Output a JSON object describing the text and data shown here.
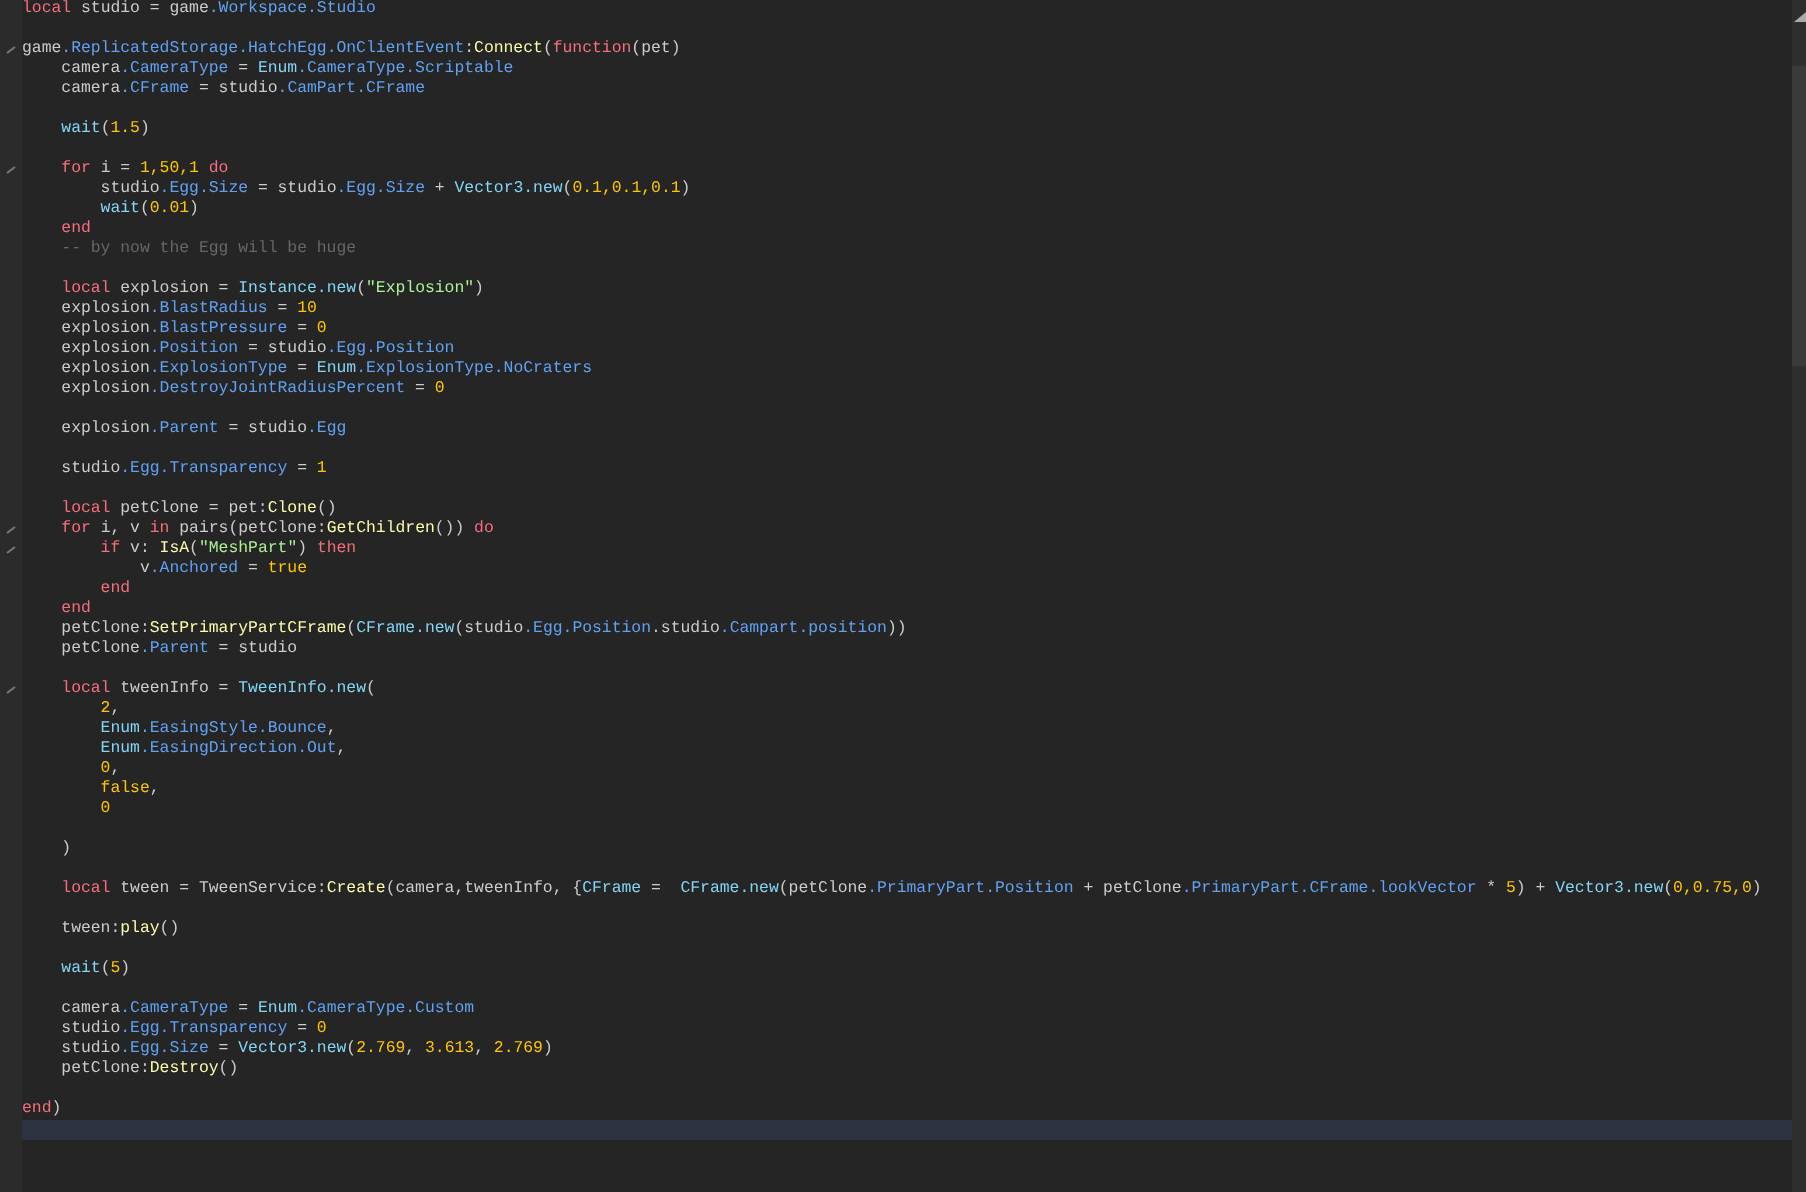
{
  "editor": {
    "blocks": [
      {
        "lines": [
          {
            "fold": false,
            "current": false,
            "tokens": [
              {
                "text": "local",
                "kind": "keyword"
              },
              {
                "text": " studio = game",
                "kind": "plain"
              },
              {
                "text": ".Workspace.Studio",
                "kind": "field"
              }
            ]
          }
        ]
      },
      {
        "lines": [
          {
            "fold": true,
            "current": false,
            "tokens": [
              {
                "text": "game",
                "kind": "plain"
              },
              {
                "text": ".ReplicatedStorage.HatchEgg.OnClientEvent",
                "kind": "field"
              },
              {
                "text": ":",
                "kind": "plain"
              },
              {
                "text": "Connect",
                "kind": "method"
              },
              {
                "text": "(",
                "kind": "plain"
              },
              {
                "text": "function",
                "kind": "keyword"
              },
              {
                "text": "(pet)",
                "kind": "plain"
              }
            ]
          },
          {
            "fold": false,
            "current": false,
            "tokens": [
              {
                "text": "    camera",
                "kind": "plain"
              },
              {
                "text": ".CameraType",
                "kind": "field"
              },
              {
                "text": " = ",
                "kind": "plain"
              },
              {
                "text": "Enum",
                "kind": "builtin"
              },
              {
                "text": ".CameraType.Scriptable",
                "kind": "field"
              }
            ]
          },
          {
            "fold": false,
            "current": false,
            "tokens": [
              {
                "text": "    camera",
                "kind": "plain"
              },
              {
                "text": ".CFrame",
                "kind": "field"
              },
              {
                "text": " = studio",
                "kind": "plain"
              },
              {
                "text": ".CamPart.CFrame",
                "kind": "field"
              }
            ]
          }
        ]
      },
      {
        "lines": [
          {
            "fold": false,
            "current": false,
            "tokens": [
              {
                "text": "    wait",
                "kind": "builtin"
              },
              {
                "text": "(",
                "kind": "plain"
              },
              {
                "text": "1.5",
                "kind": "number"
              },
              {
                "text": ")",
                "kind": "plain"
              }
            ]
          }
        ]
      },
      {
        "lines": [
          {
            "fold": true,
            "current": false,
            "tokens": [
              {
                "text": "    for",
                "kind": "keyword"
              },
              {
                "text": " i = ",
                "kind": "plain"
              },
              {
                "text": "1,50,1",
                "kind": "number"
              },
              {
                "text": " do",
                "kind": "keyword"
              }
            ]
          },
          {
            "fold": false,
            "current": false,
            "tokens": [
              {
                "text": "        studio",
                "kind": "plain"
              },
              {
                "text": ".Egg.Size",
                "kind": "field"
              },
              {
                "text": " = studio",
                "kind": "plain"
              },
              {
                "text": ".Egg.Size",
                "kind": "field"
              },
              {
                "text": " + ",
                "kind": "plain"
              },
              {
                "text": "Vector3.new",
                "kind": "builtin"
              },
              {
                "text": "(",
                "kind": "plain"
              },
              {
                "text": "0.1,0.1,0.1",
                "kind": "number"
              },
              {
                "text": ")",
                "kind": "plain"
              }
            ]
          },
          {
            "fold": false,
            "current": false,
            "tokens": [
              {
                "text": "        wait",
                "kind": "builtin"
              },
              {
                "text": "(",
                "kind": "plain"
              },
              {
                "text": "0.01",
                "kind": "number"
              },
              {
                "text": ")",
                "kind": "plain"
              }
            ]
          },
          {
            "fold": false,
            "current": false,
            "tokens": [
              {
                "text": "    end",
                "kind": "keyword"
              }
            ]
          },
          {
            "fold": false,
            "current": false,
            "tokens": [
              {
                "text": "    -- by now the Egg will be huge",
                "kind": "comment"
              }
            ]
          }
        ]
      },
      {
        "lines": [
          {
            "fold": false,
            "current": false,
            "tokens": [
              {
                "text": "    local",
                "kind": "keyword"
              },
              {
                "text": " explosion = ",
                "kind": "plain"
              },
              {
                "text": "Instance.new",
                "kind": "builtin"
              },
              {
                "text": "(",
                "kind": "plain"
              },
              {
                "text": "\"Explosion\"",
                "kind": "string"
              },
              {
                "text": ")",
                "kind": "plain"
              }
            ]
          },
          {
            "fold": false,
            "current": false,
            "tokens": [
              {
                "text": "    explosion",
                "kind": "plain"
              },
              {
                "text": ".BlastRadius",
                "kind": "field"
              },
              {
                "text": " = ",
                "kind": "plain"
              },
              {
                "text": "10",
                "kind": "number"
              }
            ]
          },
          {
            "fold": false,
            "current": false,
            "tokens": [
              {
                "text": "    explosion",
                "kind": "plain"
              },
              {
                "text": ".BlastPressure",
                "kind": "field"
              },
              {
                "text": " = ",
                "kind": "plain"
              },
              {
                "text": "0",
                "kind": "number"
              }
            ]
          },
          {
            "fold": false,
            "current": false,
            "tokens": [
              {
                "text": "    explosion",
                "kind": "plain"
              },
              {
                "text": ".Position",
                "kind": "field"
              },
              {
                "text": " = studio",
                "kind": "plain"
              },
              {
                "text": ".Egg.Position",
                "kind": "field"
              }
            ]
          },
          {
            "fold": false,
            "current": false,
            "tokens": [
              {
                "text": "    explosion",
                "kind": "plain"
              },
              {
                "text": ".ExplosionType",
                "kind": "field"
              },
              {
                "text": " = ",
                "kind": "plain"
              },
              {
                "text": "Enum",
                "kind": "builtin"
              },
              {
                "text": ".ExplosionType.NoCraters",
                "kind": "field"
              }
            ]
          },
          {
            "fold": false,
            "current": false,
            "tokens": [
              {
                "text": "    explosion",
                "kind": "plain"
              },
              {
                "text": ".DestroyJointRadiusPercent",
                "kind": "field"
              },
              {
                "text": " = ",
                "kind": "plain"
              },
              {
                "text": "0",
                "kind": "number"
              }
            ]
          }
        ]
      },
      {
        "lines": [
          {
            "fold": false,
            "current": false,
            "tokens": [
              {
                "text": "    explosion",
                "kind": "plain"
              },
              {
                "text": ".Parent",
                "kind": "field"
              },
              {
                "text": " = studio",
                "kind": "plain"
              },
              {
                "text": ".Egg",
                "kind": "field"
              }
            ]
          }
        ]
      },
      {
        "lines": [
          {
            "fold": false,
            "current": false,
            "tokens": [
              {
                "text": "    studio",
                "kind": "plain"
              },
              {
                "text": ".Egg.Transparency",
                "kind": "field"
              },
              {
                "text": " = ",
                "kind": "plain"
              },
              {
                "text": "1",
                "kind": "number"
              }
            ]
          }
        ]
      },
      {
        "lines": [
          {
            "fold": false,
            "current": false,
            "tokens": [
              {
                "text": "    local",
                "kind": "keyword"
              },
              {
                "text": " petClone = pet:",
                "kind": "plain"
              },
              {
                "text": "Clone",
                "kind": "method"
              },
              {
                "text": "()",
                "kind": "plain"
              }
            ]
          },
          {
            "fold": true,
            "current": false,
            "tokens": [
              {
                "text": "    for",
                "kind": "keyword"
              },
              {
                "text": " i, v ",
                "kind": "plain"
              },
              {
                "text": "in",
                "kind": "keyword"
              },
              {
                "text": " pairs(petClone:",
                "kind": "plain"
              },
              {
                "text": "GetChildren",
                "kind": "method"
              },
              {
                "text": "()) ",
                "kind": "plain"
              },
              {
                "text": "do",
                "kind": "keyword"
              }
            ]
          },
          {
            "fold": true,
            "current": false,
            "tokens": [
              {
                "text": "        if",
                "kind": "keyword"
              },
              {
                "text": " v: ",
                "kind": "plain"
              },
              {
                "text": "IsA",
                "kind": "method"
              },
              {
                "text": "(",
                "kind": "plain"
              },
              {
                "text": "\"MeshPart\"",
                "kind": "string"
              },
              {
                "text": ") ",
                "kind": "plain"
              },
              {
                "text": "then",
                "kind": "keyword"
              }
            ]
          },
          {
            "fold": false,
            "current": false,
            "tokens": [
              {
                "text": "            v",
                "kind": "plain"
              },
              {
                "text": ".Anchored",
                "kind": "field"
              },
              {
                "text": " = ",
                "kind": "plain"
              },
              {
                "text": "true",
                "kind": "number"
              }
            ]
          },
          {
            "fold": false,
            "current": false,
            "tokens": [
              {
                "text": "        end",
                "kind": "keyword"
              }
            ]
          },
          {
            "fold": false,
            "current": false,
            "tokens": [
              {
                "text": "    end",
                "kind": "keyword"
              }
            ]
          },
          {
            "fold": false,
            "current": false,
            "tokens": [
              {
                "text": "    petClone:",
                "kind": "plain"
              },
              {
                "text": "SetPrimaryPartCFrame",
                "kind": "method"
              },
              {
                "text": "(",
                "kind": "plain"
              },
              {
                "text": "CFrame.new",
                "kind": "builtin"
              },
              {
                "text": "(studio",
                "kind": "plain"
              },
              {
                "text": ".Egg.Position",
                "kind": "field"
              },
              {
                "text": ".studio",
                "kind": "plain"
              },
              {
                "text": ".Campart.position",
                "kind": "field"
              },
              {
                "text": "))",
                "kind": "plain"
              }
            ]
          },
          {
            "fold": false,
            "current": false,
            "tokens": [
              {
                "text": "    petClone",
                "kind": "plain"
              },
              {
                "text": ".Parent",
                "kind": "field"
              },
              {
                "text": " = studio",
                "kind": "plain"
              }
            ]
          }
        ]
      },
      {
        "lines": [
          {
            "fold": true,
            "current": false,
            "tokens": [
              {
                "text": "    local",
                "kind": "keyword"
              },
              {
                "text": " tweenInfo = ",
                "kind": "plain"
              },
              {
                "text": "TweenInfo.new",
                "kind": "builtin"
              },
              {
                "text": "(",
                "kind": "plain"
              }
            ]
          },
          {
            "fold": false,
            "current": false,
            "tokens": [
              {
                "text": "        2",
                "kind": "number"
              },
              {
                "text": ",",
                "kind": "plain"
              }
            ]
          },
          {
            "fold": false,
            "current": false,
            "tokens": [
              {
                "text": "        Enum",
                "kind": "builtin"
              },
              {
                "text": ".EasingStyle.Bounce",
                "kind": "field"
              },
              {
                "text": ",",
                "kind": "plain"
              }
            ]
          },
          {
            "fold": false,
            "current": false,
            "tokens": [
              {
                "text": "        Enum",
                "kind": "builtin"
              },
              {
                "text": ".EasingDirection.Out",
                "kind": "field"
              },
              {
                "text": ",",
                "kind": "plain"
              }
            ]
          },
          {
            "fold": false,
            "current": false,
            "tokens": [
              {
                "text": "        0",
                "kind": "number"
              },
              {
                "text": ",",
                "kind": "plain"
              }
            ]
          },
          {
            "fold": false,
            "current": false,
            "tokens": [
              {
                "text": "        false",
                "kind": "number"
              },
              {
                "text": ",",
                "kind": "plain"
              }
            ]
          },
          {
            "fold": false,
            "current": false,
            "tokens": [
              {
                "text": "        0",
                "kind": "number"
              }
            ]
          }
        ]
      },
      {
        "lines": [
          {
            "fold": false,
            "current": false,
            "tokens": [
              {
                "text": "    )",
                "kind": "plain"
              }
            ]
          }
        ]
      },
      {
        "lines": [
          {
            "fold": false,
            "current": false,
            "tokens": [
              {
                "text": "    local",
                "kind": "keyword"
              },
              {
                "text": " tween = TweenService:",
                "kind": "plain"
              },
              {
                "text": "Create",
                "kind": "method"
              },
              {
                "text": "(camera,tweenInfo, {",
                "kind": "plain"
              },
              {
                "text": "CFrame",
                "kind": "builtin"
              },
              {
                "text": " =  ",
                "kind": "plain"
              },
              {
                "text": "CFrame.new",
                "kind": "builtin"
              },
              {
                "text": "(petClone",
                "kind": "plain"
              },
              {
                "text": ".PrimaryPart.Position",
                "kind": "field"
              },
              {
                "text": " + petClone",
                "kind": "plain"
              },
              {
                "text": ".PrimaryPart.CFrame.lookVector",
                "kind": "field"
              },
              {
                "text": " * ",
                "kind": "plain"
              },
              {
                "text": "5",
                "kind": "number"
              },
              {
                "text": ") + ",
                "kind": "plain"
              },
              {
                "text": "Vector3.new",
                "kind": "builtin"
              },
              {
                "text": "(",
                "kind": "plain"
              },
              {
                "text": "0,0.75,0",
                "kind": "number"
              },
              {
                "text": ")",
                "kind": "plain"
              }
            ]
          }
        ]
      },
      {
        "lines": [
          {
            "fold": false,
            "current": false,
            "tokens": [
              {
                "text": "    tween:",
                "kind": "plain"
              },
              {
                "text": "play",
                "kind": "method"
              },
              {
                "text": "()",
                "kind": "plain"
              }
            ]
          }
        ]
      },
      {
        "lines": [
          {
            "fold": false,
            "current": false,
            "tokens": [
              {
                "text": "    wait",
                "kind": "builtin"
              },
              {
                "text": "(",
                "kind": "plain"
              },
              {
                "text": "5",
                "kind": "number"
              },
              {
                "text": ")",
                "kind": "plain"
              }
            ]
          }
        ]
      },
      {
        "lines": [
          {
            "fold": false,
            "current": false,
            "tokens": [
              {
                "text": "    camera",
                "kind": "plain"
              },
              {
                "text": ".CameraType",
                "kind": "field"
              },
              {
                "text": " = ",
                "kind": "plain"
              },
              {
                "text": "Enum",
                "kind": "builtin"
              },
              {
                "text": ".CameraType.Custom",
                "kind": "field"
              }
            ]
          },
          {
            "fold": false,
            "current": false,
            "tokens": [
              {
                "text": "    studio",
                "kind": "plain"
              },
              {
                "text": ".Egg.Transparency",
                "kind": "field"
              },
              {
                "text": " = ",
                "kind": "plain"
              },
              {
                "text": "0",
                "kind": "number"
              }
            ]
          },
          {
            "fold": false,
            "current": false,
            "tokens": [
              {
                "text": "    studio",
                "kind": "plain"
              },
              {
                "text": ".Egg.Size",
                "kind": "field"
              },
              {
                "text": " = ",
                "kind": "plain"
              },
              {
                "text": "Vector3.new",
                "kind": "builtin"
              },
              {
                "text": "(",
                "kind": "plain"
              },
              {
                "text": "2.769",
                "kind": "number"
              },
              {
                "text": ", ",
                "kind": "plain"
              },
              {
                "text": "3.613",
                "kind": "number"
              },
              {
                "text": ", ",
                "kind": "plain"
              },
              {
                "text": "2.769",
                "kind": "number"
              },
              {
                "text": ")",
                "kind": "plain"
              }
            ]
          },
          {
            "fold": false,
            "current": false,
            "tokens": [
              {
                "text": "    petClone:",
                "kind": "plain"
              },
              {
                "text": "Destroy",
                "kind": "method"
              },
              {
                "text": "()",
                "kind": "plain"
              }
            ]
          }
        ]
      },
      {
        "lines": [
          {
            "fold": false,
            "current": false,
            "tokens": [
              {
                "text": "end",
                "kind": "keyword"
              },
              {
                "text": ")",
                "kind": "plain"
              }
            ]
          },
          {
            "fold": false,
            "current": true
          }
        ]
      }
    ]
  }
}
